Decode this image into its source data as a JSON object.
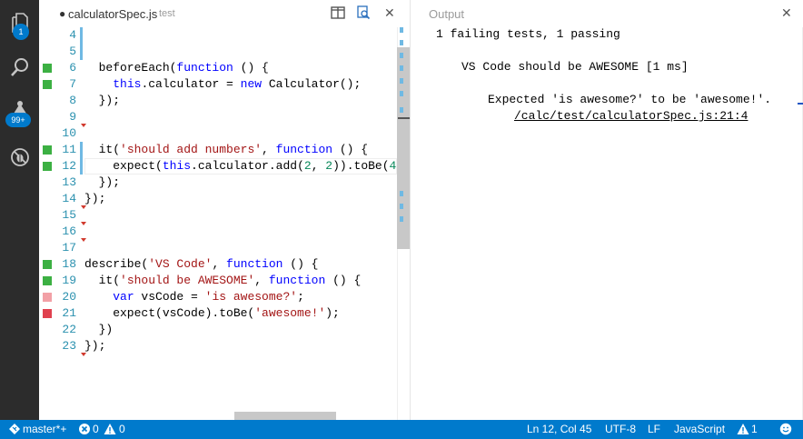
{
  "activity_bar": {
    "explorer_badge": "1",
    "git_badge": "99+"
  },
  "editor": {
    "tab": {
      "dirty_marker": "●",
      "title": "calculatorSpec.js",
      "description": "test"
    },
    "close_glyph": "✕",
    "lines": [
      {
        "n": "4",
        "gutter": ""
      },
      {
        "n": "5",
        "gutter": ""
      },
      {
        "n": "6",
        "gutter": "pass"
      },
      {
        "n": "7",
        "gutter": "pass"
      },
      {
        "n": "8",
        "gutter": ""
      },
      {
        "n": "9",
        "gutter": ""
      },
      {
        "n": "10",
        "gutter": ""
      },
      {
        "n": "11",
        "gutter": "pass"
      },
      {
        "n": "12",
        "gutter": "pass"
      },
      {
        "n": "13",
        "gutter": ""
      },
      {
        "n": "14",
        "gutter": ""
      },
      {
        "n": "15",
        "gutter": ""
      },
      {
        "n": "16",
        "gutter": ""
      },
      {
        "n": "17",
        "gutter": ""
      },
      {
        "n": "18",
        "gutter": "pass"
      },
      {
        "n": "19",
        "gutter": "pass"
      },
      {
        "n": "20",
        "gutter": "fail-light"
      },
      {
        "n": "21",
        "gutter": "fail"
      },
      {
        "n": "22",
        "gutter": ""
      },
      {
        "n": "23",
        "gutter": ""
      }
    ],
    "code": {
      "l6": [
        "  beforeEach(",
        "function",
        " () {"
      ],
      "l7": [
        "    ",
        "this",
        ".calculator = ",
        "new",
        " Calculator();"
      ],
      "l8": "  });",
      "l11": [
        "  it(",
        "'should add numbers'",
        ", ",
        "function",
        " () {"
      ],
      "l12": [
        "    expect(",
        "this",
        ".calculator.add(",
        "2",
        ", ",
        "2",
        ")).toBe(",
        "4",
        ");"
      ],
      "l13": "  });",
      "l14": "});",
      "l18": [
        "describe(",
        "'VS Code'",
        ", ",
        "function",
        " () {"
      ],
      "l19": [
        "  it(",
        "'should be AWESOME'",
        ", ",
        "function",
        " () {"
      ],
      "l20": [
        "    ",
        "var",
        " vsCode = ",
        "'is awesome?'",
        ";"
      ],
      "l21": [
        "    expect(vsCode).toBe(",
        "'awesome!'",
        ");"
      ],
      "l22": "  })",
      "l23": "});"
    }
  },
  "output": {
    "title": "Output",
    "close_glyph": "✕",
    "lines": {
      "summary": "1 failing tests, 1 passing",
      "suite": "VS Code should be AWESOME [1 ms]",
      "expected": "Expected 'is awesome?' to be 'awesome!'.",
      "location": "/calc/test/calculatorSpec.js:21:4"
    }
  },
  "status_bar": {
    "branch": "master*+",
    "errors": "0",
    "warnings": "0",
    "position": "Ln 12, Col 45",
    "encoding": "UTF-8",
    "eol": "LF",
    "language": "JavaScript",
    "problems": "1"
  },
  "colors": {
    "activity_bar": "#2c2c2c",
    "status_bar": "#007acc",
    "pass": "#3cb043",
    "fail": "#e0414f",
    "fail_light": "#f2a0a6"
  }
}
